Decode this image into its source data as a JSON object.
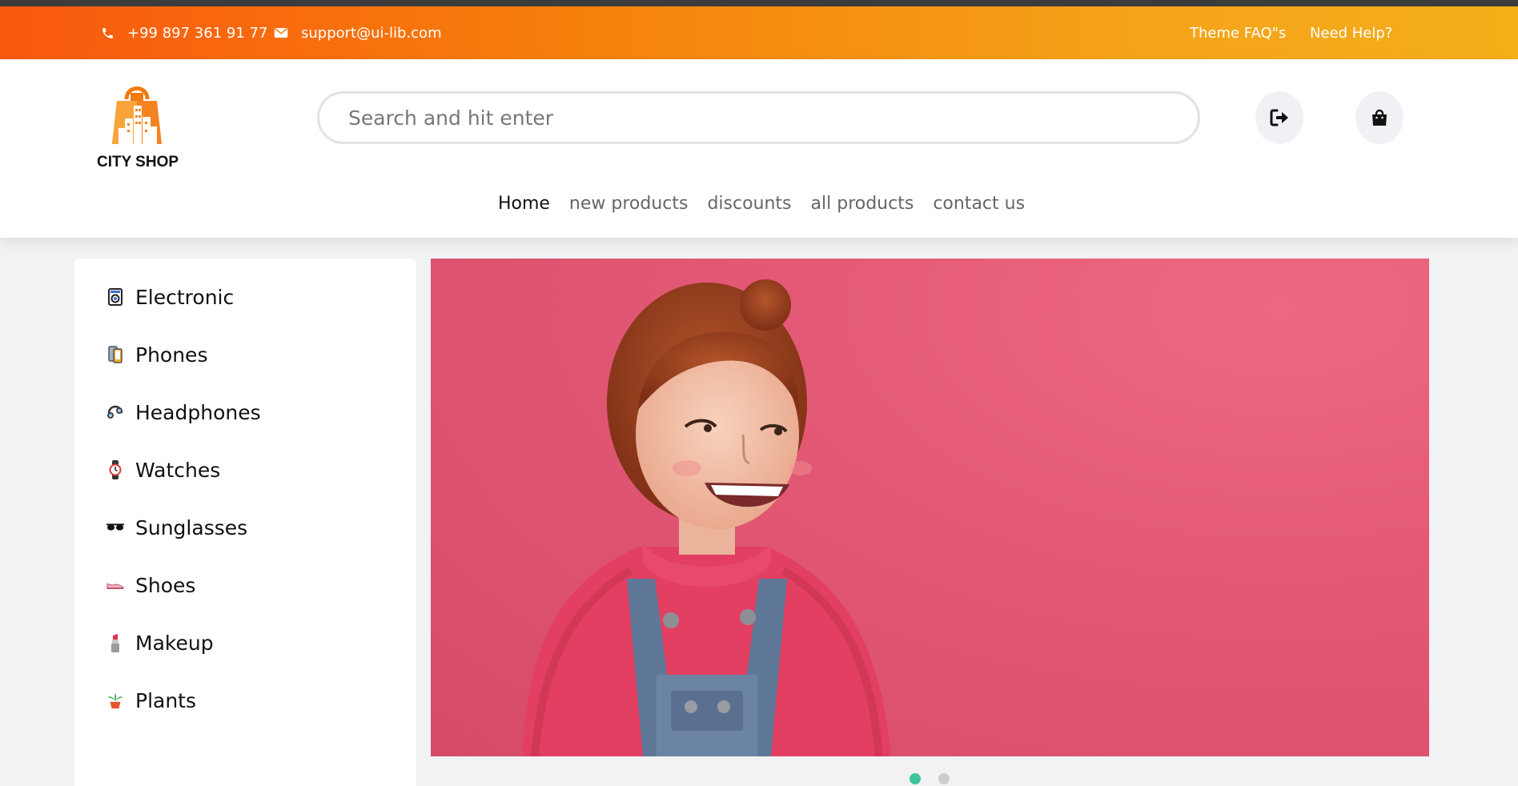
{
  "topbar": {
    "phone": "+99 897 361 91 77",
    "email": "support@ui-lib.com",
    "links": [
      "Theme FAQ\"s",
      "Need Help?"
    ]
  },
  "header": {
    "logo_text": "CITY SHOP",
    "search_placeholder": "Search and hit enter",
    "icons": [
      "sign-out-icon",
      "shopping-bag-icon"
    ]
  },
  "nav": [
    {
      "label": "Home",
      "active": true
    },
    {
      "label": "new products",
      "active": false
    },
    {
      "label": "discounts",
      "active": false
    },
    {
      "label": "all products",
      "active": false
    },
    {
      "label": "contact us",
      "active": false
    }
  ],
  "categories": [
    {
      "label": "Electronic",
      "icon": "washing-machine-icon"
    },
    {
      "label": "Phones",
      "icon": "phone-icon"
    },
    {
      "label": "Headphones",
      "icon": "headphones-icon"
    },
    {
      "label": "Watches",
      "icon": "watch-icon"
    },
    {
      "label": "Sunglasses",
      "icon": "sunglasses-icon"
    },
    {
      "label": "Shoes",
      "icon": "shoe-icon"
    },
    {
      "label": "Makeup",
      "icon": "lipstick-icon"
    },
    {
      "label": "Plants",
      "icon": "plant-icon"
    }
  ],
  "hero": {
    "slide_count": 2,
    "active_slide": 1
  },
  "colors": {
    "topbar_start": "#f9580f",
    "topbar_end": "#f4ae18",
    "hero_bg": "#e45a76",
    "dot_active": "#40c39a"
  }
}
